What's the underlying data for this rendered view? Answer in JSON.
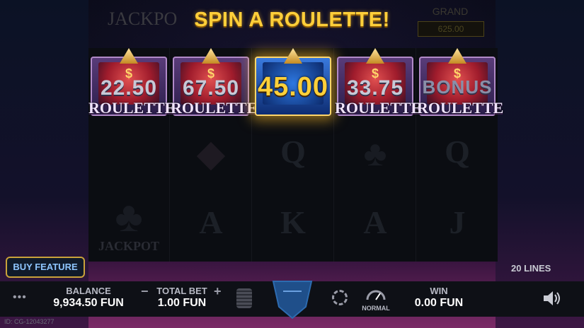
{
  "header": {
    "title": "SPIN A ROULETTE!",
    "jackpot_label": "JACKPO",
    "grand_label": "GRAND",
    "grand_value": "625.00"
  },
  "reels": {
    "top_row": [
      {
        "amount": "22.50",
        "label": "ROULETTE",
        "active": false
      },
      {
        "amount": "67.50",
        "label": "ROULETTE",
        "active": false
      },
      {
        "amount": "45.00",
        "label": "",
        "active": true
      },
      {
        "amount": "33.75",
        "label": "ROULETTE",
        "active": false
      },
      {
        "amount": "BONUS",
        "label": "ROULETTE",
        "active": false
      }
    ],
    "dim_symbols": [
      "Q",
      "Q",
      "A",
      "K",
      "A",
      "J"
    ],
    "dim_jackpot": "JACKPOT"
  },
  "buttons": {
    "buy_feature": "BUY FEATURE",
    "speed_label": "NORMAL"
  },
  "lines": "20 LINES",
  "footer": {
    "balance_label": "BALANCE",
    "balance_value": "9,934.50 FUN",
    "total_bet_label": "TOTAL BET",
    "total_bet_value": "1.00 FUN",
    "minus": "−",
    "plus": "+",
    "win_label": "WIN",
    "win_value": "0.00 FUN",
    "menu": "•••"
  },
  "session_id": "ID: CG-12043277",
  "colors": {
    "accent": "#ffcf3a",
    "buy_border": "#c9a23a",
    "buy_text": "#8fc6ff"
  }
}
